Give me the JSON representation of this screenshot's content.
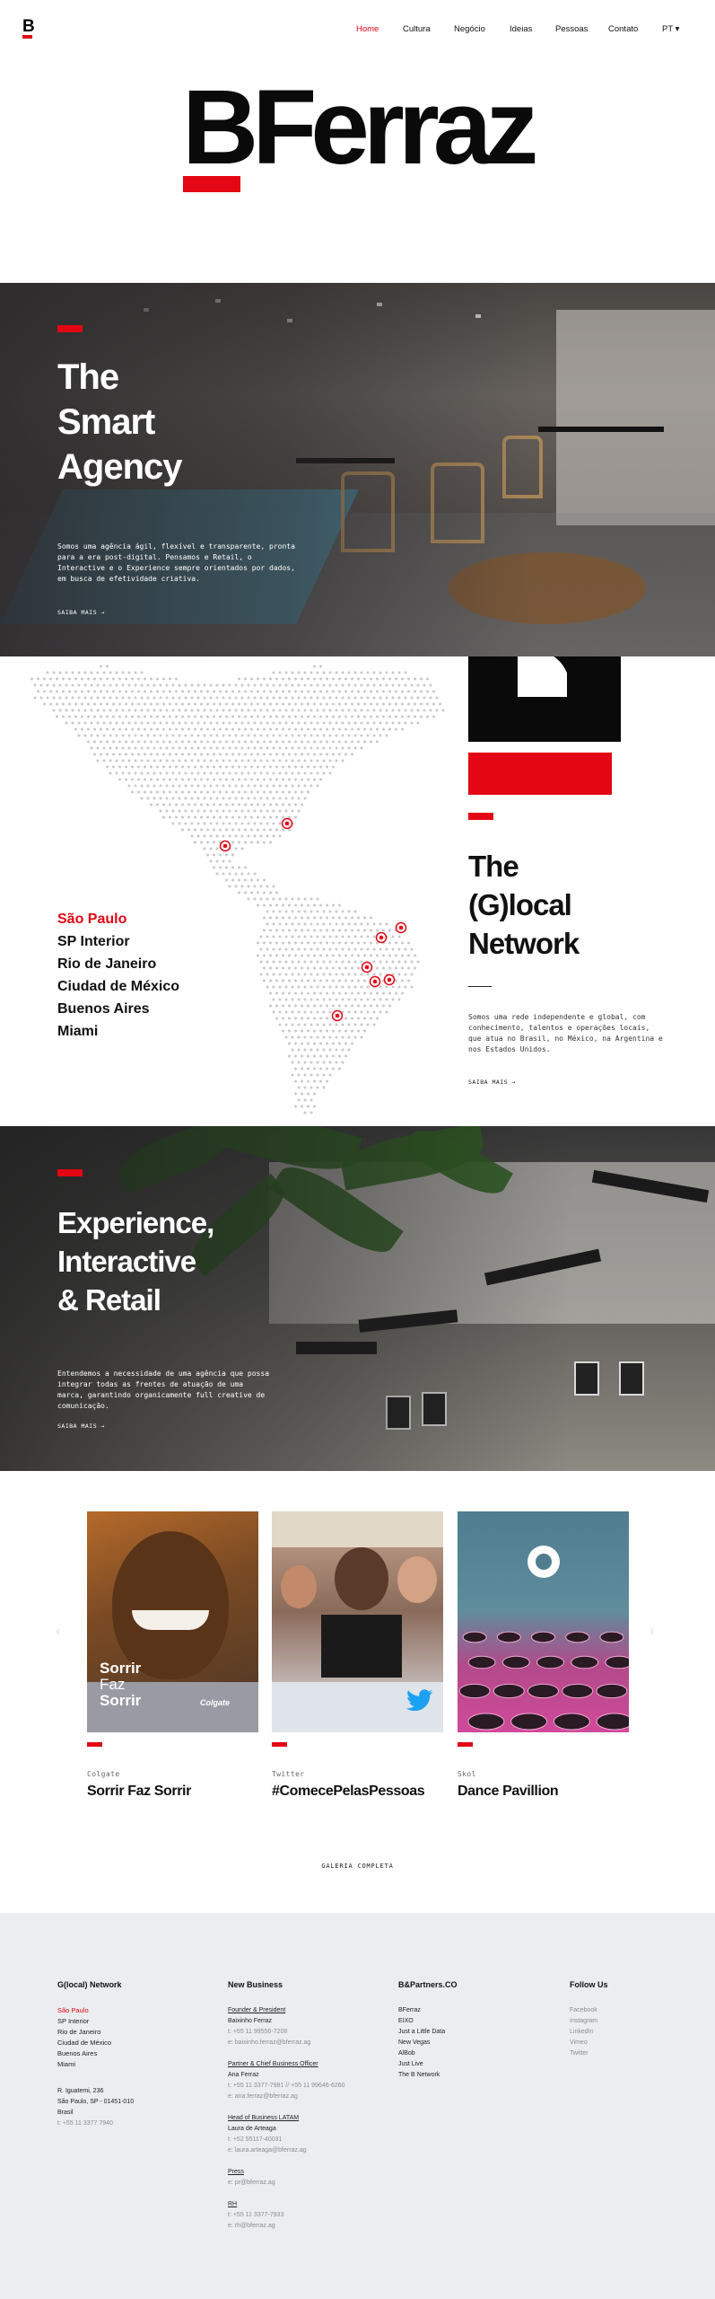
{
  "nav": {
    "logo_letter": "B",
    "items": [
      "Home",
      "Cultura",
      "Negócio",
      "Ideias",
      "Pessoas",
      "Contato"
    ],
    "active_index": 0,
    "language": "PT ▾"
  },
  "brand": {
    "name": "BFerraz"
  },
  "hero_smart": {
    "title": "The\nSmart\nAgency",
    "body": "Somos uma agência ágil, flexível e transparente, pronta para a era post-digital. Pensamos e Retail, o Interactive e o Experience sempre orientados por dados, em busca de efetividade criativa.",
    "link": "SAIBA MAIS →"
  },
  "network": {
    "cities": [
      "São Paulo",
      "SP Interior",
      "Rio de Janeiro",
      "Ciudad de México",
      "Buenos Aires",
      "Miami"
    ],
    "active_city_index": 0,
    "title": "The\n(G)local\nNetwork",
    "body": "Somos uma rede independente e global, com conhecimento, talentos e operações locais, que atua no Brasil, no México, na Argentina e nos Estados Unidos.",
    "link": "SAIBA MAIS →"
  },
  "hero_experience": {
    "title": "Experience,\nInteractive\n& Retail",
    "body": "Entendemos a necessidade de uma agência que possa integrar todas as frentes de atuação de uma marca, garantindo organicamente full creative de comunicação.",
    "link": "SAIBA MAIS →"
  },
  "cards": [
    {
      "source": "Colgate",
      "title": "Sorrir Faz Sorrir",
      "overlay": [
        "Sorrir",
        "Faz",
        "Sorrir"
      ],
      "overlay_brand": "Colgate"
    },
    {
      "source": "Twitter",
      "title": "#ComecePelasPessoas"
    },
    {
      "source": "Skol",
      "title": "Dance Pavillion"
    }
  ],
  "gallery_link": "GALERIA COMPLETA",
  "footer": {
    "col1": {
      "heading": "G(local) Network",
      "cities": [
        "São Paulo",
        "SP Interior",
        "Rio de Janeiro",
        "Ciudad de México",
        "Buenos Aires",
        "Miami"
      ],
      "address": [
        "R. Iguatemi, 236",
        "São Paulo, SP - 01451-010",
        "Brasil"
      ],
      "phone": "t: +55 11 3377 7940"
    },
    "col2": {
      "heading": "New Business",
      "r1_role": "Founder & President",
      "r1_name": "Baixinho Ferraz",
      "r1_t": "t: +55 11 99556-7208",
      "r1_e": "e: baixinho.ferraz@bferraz.ag",
      "r2_role": "Partner & Chief Business Officer",
      "r2_name": "Ana Ferraz",
      "r2_t": "t: +55 11 3377-7981 // +55 11 99646-6260",
      "r2_e": "e: ana.ferraz@bferraz.ag",
      "r3_role": "Head of Business LATAM",
      "r3_name": "Laura de Arteaga",
      "r3_t": "t: +52 55117-40031",
      "r3_e": "e: laura.arteaga@bferraz.ag",
      "r4_role": "Press",
      "r4_e": "e: pr@bferraz.ag",
      "r5_role": "RH",
      "r5_t": "t: +55 11 3377-7933",
      "r5_e": "e: rh@bferraz.ag"
    },
    "col3": {
      "heading": "B&Partners.CO",
      "items": [
        "BFerraz",
        "EIXO",
        "Just a Little Data",
        "New Vegas",
        "AlBob",
        "Just Live",
        "The B Network"
      ]
    },
    "col4": {
      "heading": "Follow Us",
      "items": [
        "Facebook",
        "Instagram",
        "LinkedIn",
        "Vimeo",
        "Twitter"
      ]
    }
  },
  "colors": {
    "accent": "#e30613",
    "footer_bg": "#ebedf1",
    "text": "#111111"
  }
}
